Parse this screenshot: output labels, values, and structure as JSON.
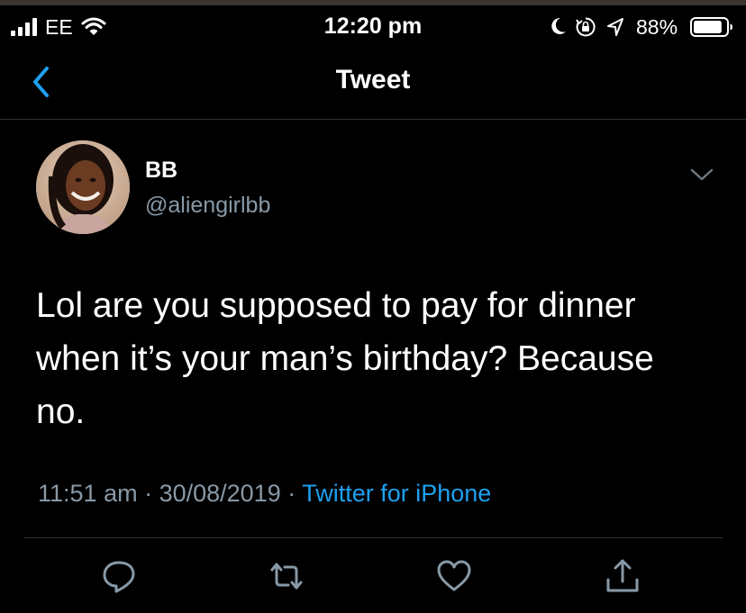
{
  "status_bar": {
    "carrier": "EE",
    "time": "12:20 pm",
    "battery_percent": "88%",
    "battery_level": 0.88,
    "icons": [
      "signal-icon",
      "wifi-icon",
      "moon-icon",
      "rotation-lock-icon",
      "location-arrow-icon",
      "battery-icon"
    ]
  },
  "nav": {
    "title": "Tweet",
    "back_icon": "chevron-left-icon"
  },
  "tweet": {
    "author_name": "BB",
    "author_handle": "@aliengirlbb",
    "text": "Lol are you supposed to pay for dinner\nwhen it’s your man’s birthday? Because\nno.",
    "time": "11:51 am",
    "separator_1": " · ",
    "date": "30/08/2019",
    "separator_2": " · ",
    "source": "Twitter for iPhone",
    "menu_icon": "chevron-down-icon"
  },
  "actions": [
    "reply-icon",
    "retweet-icon",
    "like-icon",
    "share-icon"
  ],
  "colors": {
    "background": "#000000",
    "text_primary": "#ffffff",
    "text_secondary": "#8899a6",
    "accent": "#1da1f2",
    "divider": "#2f3336"
  }
}
